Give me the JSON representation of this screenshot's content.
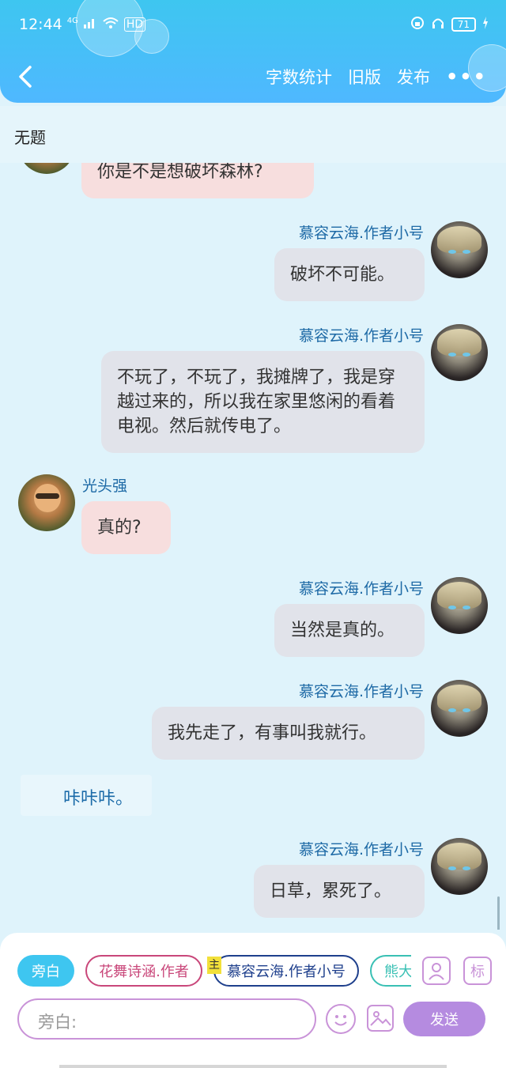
{
  "status_bar": {
    "time": "12:44",
    "signal": "4G",
    "hd": "HD",
    "battery": "71"
  },
  "header": {
    "actions": [
      {
        "label": "字数统计"
      },
      {
        "label": "旧版"
      },
      {
        "label": "发布"
      }
    ],
    "more_label": "•••"
  },
  "page_title": "无题",
  "messages": [
    {
      "text": "你是不是想破坏森林?"
    },
    {
      "name": "慕容云海.作者小号",
      "text": "破坏不可能。"
    },
    {
      "name": "慕容云海.作者小号",
      "text": "不玩了，不玩了，我摊牌了，我是穿越过来的，所以我在家里悠闲的看着电视。然后就传电了。"
    },
    {
      "name": "光头强",
      "text": "真的?"
    },
    {
      "name": "慕容云海.作者小号",
      "text": "当然是真的。"
    },
    {
      "name": "慕容云海.作者小号",
      "text": "我先走了，有事叫我就行。"
    },
    {
      "text": "咔咔咔。"
    },
    {
      "name": "慕容云海.作者小号",
      "text": "日草，累死了。"
    }
  ],
  "footer": {
    "chips": [
      {
        "label": "旁白"
      },
      {
        "label": "花舞诗涵.作者"
      },
      {
        "label": "慕容云海.作者小号"
      },
      {
        "label": "熊大"
      }
    ],
    "host_tag": "主",
    "tag_button": "标",
    "input_placeholder": "旁白:",
    "send_label": "发送"
  }
}
